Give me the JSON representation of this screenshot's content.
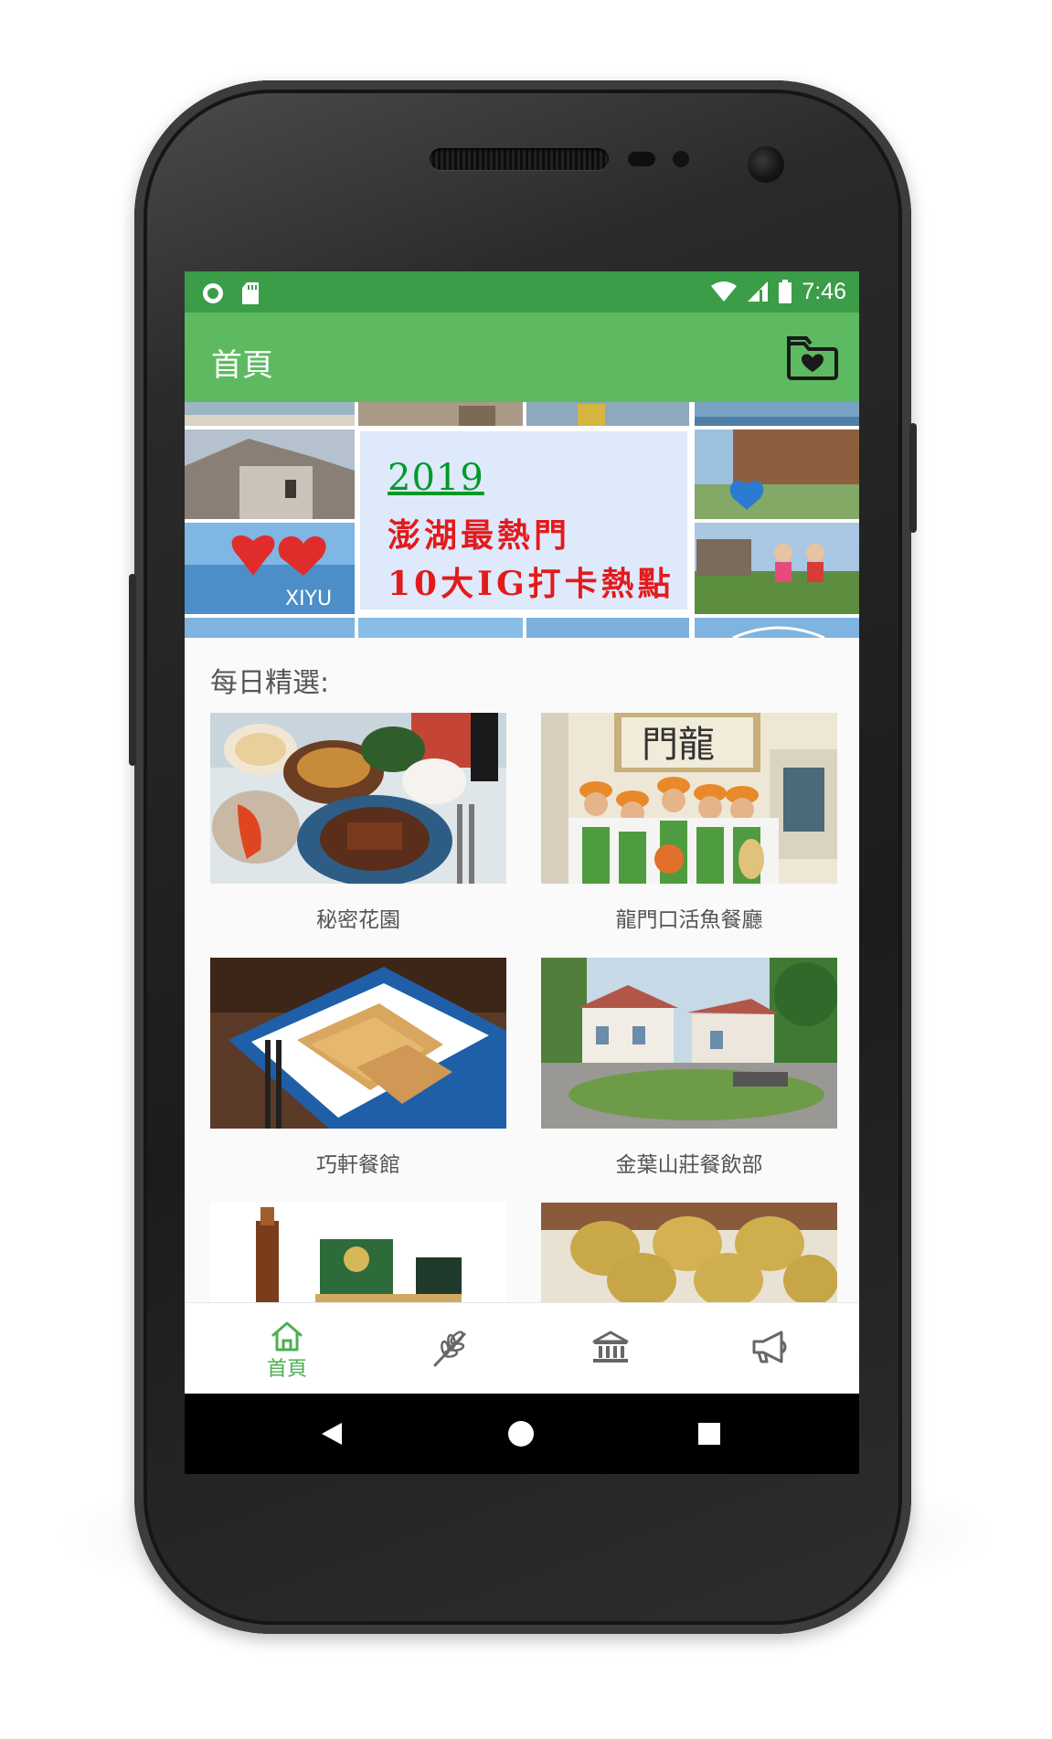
{
  "status_bar": {
    "time": "7:46",
    "left_icons": [
      "circle-notification-icon",
      "sd-card-icon"
    ],
    "right_icons": [
      "wifi-icon",
      "cell-signal-icon",
      "battery-icon"
    ]
  },
  "app_bar": {
    "title": "首頁",
    "action_icon": "favorites-folder-icon"
  },
  "banner": {
    "year": "2019",
    "line1": "澎湖最熱門",
    "line2": "10大IG打卡熱點"
  },
  "daily_picks": {
    "title": "每日精選:",
    "items": [
      {
        "name": "秘密花園"
      },
      {
        "name": "龍門口活魚餐廳"
      },
      {
        "name": "巧軒餐館"
      },
      {
        "name": "金葉山莊餐飲部"
      },
      {
        "name": ""
      },
      {
        "name": ""
      }
    ]
  },
  "bottom_nav": {
    "items": [
      {
        "label": "首頁",
        "icon": "home-icon",
        "active": true
      },
      {
        "label": "",
        "icon": "wheat-icon",
        "active": false
      },
      {
        "label": "",
        "icon": "museum-icon",
        "active": false
      },
      {
        "label": "",
        "icon": "megaphone-icon",
        "active": false
      }
    ]
  },
  "colors": {
    "status_bar": "#3b9d48",
    "app_bar": "#5eba60",
    "active_nav": "#4caf50",
    "inactive_nav": "#666666",
    "banner_year": "#009a28",
    "banner_text": "#e31a1c"
  }
}
